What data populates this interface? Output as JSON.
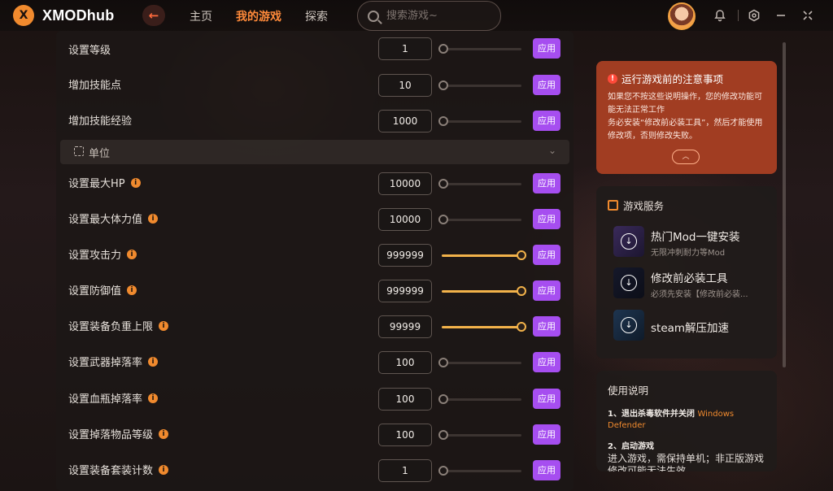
{
  "app": {
    "logo_text": "XMODhub",
    "logo_mark": "X"
  },
  "nav": {
    "back_glyph": "←",
    "items": [
      "主页",
      "我的游戏",
      "探索"
    ],
    "active_index": 1
  },
  "search": {
    "placeholder": "搜索游戏~"
  },
  "colors": {
    "accent": "#f08a2e",
    "apply": "#a64ef0",
    "slider_on": "#f2b24a",
    "notice_bg": "#a13d22"
  },
  "settings": {
    "apply_label": "应用",
    "rows_top": [
      {
        "label": "设置等级",
        "value": "1",
        "info": false,
        "level": 0
      },
      {
        "label": "增加技能点",
        "value": "10",
        "info": false,
        "level": 0
      },
      {
        "label": "增加技能经验",
        "value": "1000",
        "info": false,
        "level": 0
      }
    ],
    "section": {
      "title": "单位",
      "chevron": "⌄"
    },
    "rows_unit": [
      {
        "label": "设置最大HP",
        "value": "10000",
        "info": true,
        "level": 0
      },
      {
        "label": "设置最大体力值",
        "value": "10000",
        "info": true,
        "level": 0
      },
      {
        "label": "设置攻击力",
        "value": "999999",
        "info": true,
        "level": 1
      },
      {
        "label": "设置防御值",
        "value": "999999",
        "info": true,
        "level": 1
      },
      {
        "label": "设置装备负重上限",
        "value": "99999",
        "info": true,
        "level": 1
      },
      {
        "label": "设置武器掉落率",
        "value": "100",
        "info": true,
        "level": 0
      },
      {
        "label": "设置血瓶掉落率",
        "value": "100",
        "info": true,
        "level": 0
      },
      {
        "label": "设置掉落物品等级",
        "value": "100",
        "info": true,
        "level": 0
      },
      {
        "label": "设置装备套装计数",
        "value": "1",
        "info": true,
        "level": 0
      }
    ]
  },
  "notice": {
    "title": "运行游戏前的注意事项",
    "line1": "如果您不按这些说明操作，您的修改功能可能无法正常工作",
    "line2": "务必安装“修改前必装工具”，然后才能使用修改项，否则修改失败。",
    "collapse_glyph": "︿"
  },
  "services": {
    "title": "游戏服务",
    "items": [
      {
        "name": "热门Mod一键安装",
        "desc": "无限冲刺耐力等Mod"
      },
      {
        "name": "修改前必装工具",
        "desc": "必须先安装【修改前必装..."
      },
      {
        "name": "steam解压加速",
        "desc": ""
      }
    ]
  },
  "guide": {
    "title": "使用说明",
    "step1": "1、退出杀毒软件并关闭 ",
    "step1_hl": "Windows Defender",
    "step2": "2、启动游戏",
    "step2_body": "进入游戏，需保持单机；非正版游戏修改可能无法生效"
  }
}
